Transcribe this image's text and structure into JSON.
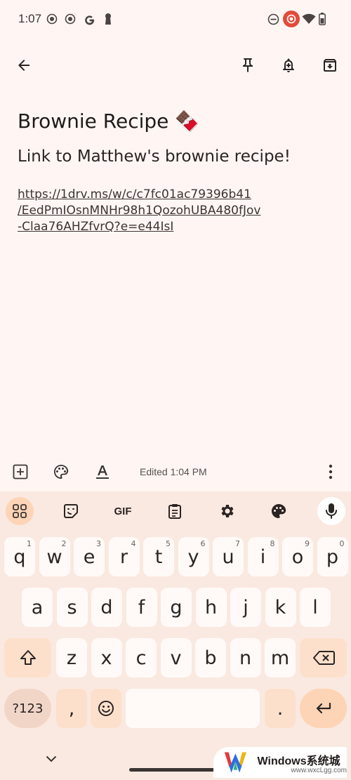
{
  "status": {
    "time": "1:07",
    "left_icons": [
      "record-icon",
      "record-icon",
      "google-icon",
      "keyhole-icon"
    ],
    "right_icons": [
      "dnd-icon",
      "cast-icon",
      "wifi-icon",
      "battery-icon"
    ]
  },
  "note": {
    "title": "Brownie Recipe 🍫",
    "body": "Link to Matthew's brownie recipe!",
    "link_lines": [
      "https://1drv.ms/w/c/c7fc01ac79396b41",
      "/EedPmIOsnMNHr98h1QozohUBA480fJov",
      "-Claa76AHZfvrQ?e=e44IsI"
    ]
  },
  "editor": {
    "edited": "Edited 1:04 PM"
  },
  "keyboard": {
    "toolbar": [
      "apps",
      "sticker",
      "GIF",
      "clipboard",
      "settings",
      "palette",
      "mic"
    ],
    "row1": [
      {
        "k": "q",
        "h": "1"
      },
      {
        "k": "w",
        "h": "2"
      },
      {
        "k": "e",
        "h": "3"
      },
      {
        "k": "r",
        "h": "4"
      },
      {
        "k": "t",
        "h": "5"
      },
      {
        "k": "y",
        "h": "6"
      },
      {
        "k": "u",
        "h": "7"
      },
      {
        "k": "i",
        "h": "8"
      },
      {
        "k": "o",
        "h": "9"
      },
      {
        "k": "p",
        "h": "0"
      }
    ],
    "row2": [
      "a",
      "s",
      "d",
      "f",
      "g",
      "h",
      "j",
      "k",
      "l"
    ],
    "row3": [
      "z",
      "x",
      "c",
      "v",
      "b",
      "n",
      "m"
    ],
    "sym_label": "?123",
    "comma": ",",
    "period": "."
  },
  "watermark": {
    "brand": "Windows系统城",
    "url": "www.wxcLgg.com"
  },
  "colors": {
    "background": "#fff6f3",
    "keyboard": "#fae9e0",
    "accent": "#fdd4b5"
  }
}
